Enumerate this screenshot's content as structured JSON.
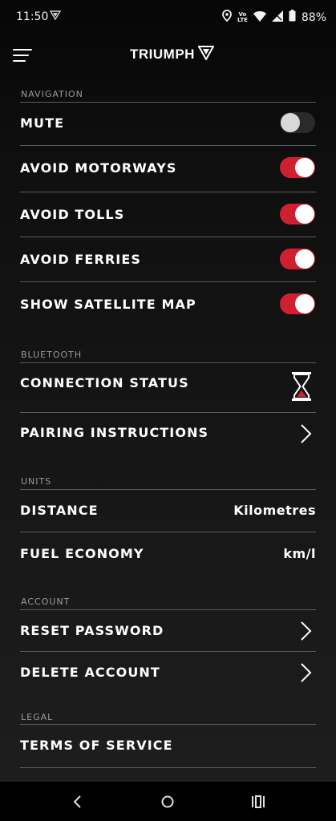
{
  "status_bar": {
    "time": "11:50",
    "volte_top": "Vo",
    "volte_bottom": "LTE",
    "battery_percent": "88%",
    "icons": [
      "triumph-app-icon",
      "location-icon",
      "volte-icon",
      "wifi-icon",
      "signal-icon",
      "battery-icon"
    ]
  },
  "header": {
    "menu_icon": "hamburger-menu-icon",
    "brand": "TRIUMPH",
    "brand_icon": "triumph-shield-icon"
  },
  "sections": {
    "navigation": {
      "title": "NAVIGATION",
      "items": [
        {
          "label": "MUTE",
          "toggle": false
        },
        {
          "label": "AVOID MOTORWAYS",
          "toggle": true
        },
        {
          "label": "AVOID TOLLS",
          "toggle": true
        },
        {
          "label": "AVOID FERRIES",
          "toggle": true
        },
        {
          "label": "SHOW SATELLITE MAP",
          "toggle": true
        }
      ]
    },
    "bluetooth": {
      "title": "BLUETOOTH",
      "items": [
        {
          "label": "CONNECTION STATUS",
          "icon": "hourglass-icon"
        },
        {
          "label": "PAIRING INSTRUCTIONS",
          "icon": "chevron-right-icon"
        }
      ]
    },
    "units": {
      "title": "UNITS",
      "items": [
        {
          "label": "DISTANCE",
          "value": "Kilometres"
        },
        {
          "label": "FUEL ECONOMY",
          "value": "km/l"
        }
      ]
    },
    "account": {
      "title": "ACCOUNT",
      "items": [
        {
          "label": "RESET PASSWORD",
          "icon": "chevron-right-icon"
        },
        {
          "label": "DELETE ACCOUNT",
          "icon": "chevron-right-icon"
        }
      ]
    },
    "legal": {
      "title": "LEGAL",
      "items": [
        {
          "label": "TERMS OF SERVICE"
        }
      ]
    }
  },
  "colors": {
    "accent_red": "#d0202f",
    "text": "#ffffff",
    "section_header": "#9a9a9a",
    "divider": "#5a5a5a"
  },
  "nav_bar": {
    "icons": [
      "back-icon",
      "home-icon",
      "recents-icon"
    ]
  }
}
